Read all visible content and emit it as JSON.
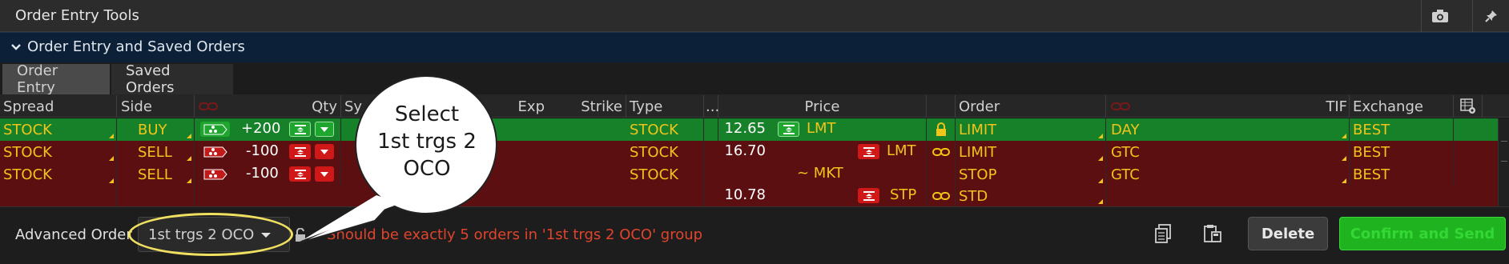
{
  "window": {
    "title": "Order Entry Tools"
  },
  "section": {
    "title": "Order Entry and Saved Orders"
  },
  "tabs": [
    {
      "label": "Order Entry"
    },
    {
      "label": "Saved Orders"
    }
  ],
  "columns": {
    "spread": "Spread",
    "side": "Side",
    "qty": "Qty",
    "sym": "Sy",
    "exp": "Exp",
    "strike": "Strike",
    "type": "Type",
    "more": "...",
    "price": "Price",
    "order": "Order",
    "tif": "TIF",
    "exchange": "Exchange"
  },
  "rows": [
    {
      "spread": "STOCK",
      "side": "BUY",
      "qty": "+200",
      "type": "STOCK",
      "price": "12.65",
      "price_type": "LMT",
      "order": "LIMIT",
      "tif": "DAY",
      "exchange": "BEST"
    },
    {
      "spread": "STOCK",
      "side": "SELL",
      "qty": "-100",
      "type": "STOCK",
      "price": "16.70",
      "price_type": "LMT",
      "order": "LIMIT",
      "tif": "GTC",
      "exchange": "BEST"
    },
    {
      "spread": "STOCK",
      "side": "SELL",
      "qty": "-100",
      "type": "STOCK",
      "price": "~ MKT",
      "order": "STOP",
      "tif": "GTC",
      "exchange": "BEST"
    },
    {
      "price": "10.78",
      "price_type": "STP",
      "order": "STD"
    }
  ],
  "callout": {
    "text": "Select 1st trgs 2 OCO"
  },
  "bottom": {
    "advanced_label": "Advanced Order",
    "advanced_value": "1st trgs 2 OCO",
    "error_message": "Should be exactly 5 orders in '1st trgs 2 OCO' group",
    "delete_label": "Delete",
    "confirm_label": "Confirm and Send"
  },
  "colors": {
    "accent_yellow": "#f0c419",
    "buy_row": "#17812a",
    "sell_row": "#5c0f10",
    "error_text": "#e0442c",
    "confirm_button": "#20b320"
  }
}
